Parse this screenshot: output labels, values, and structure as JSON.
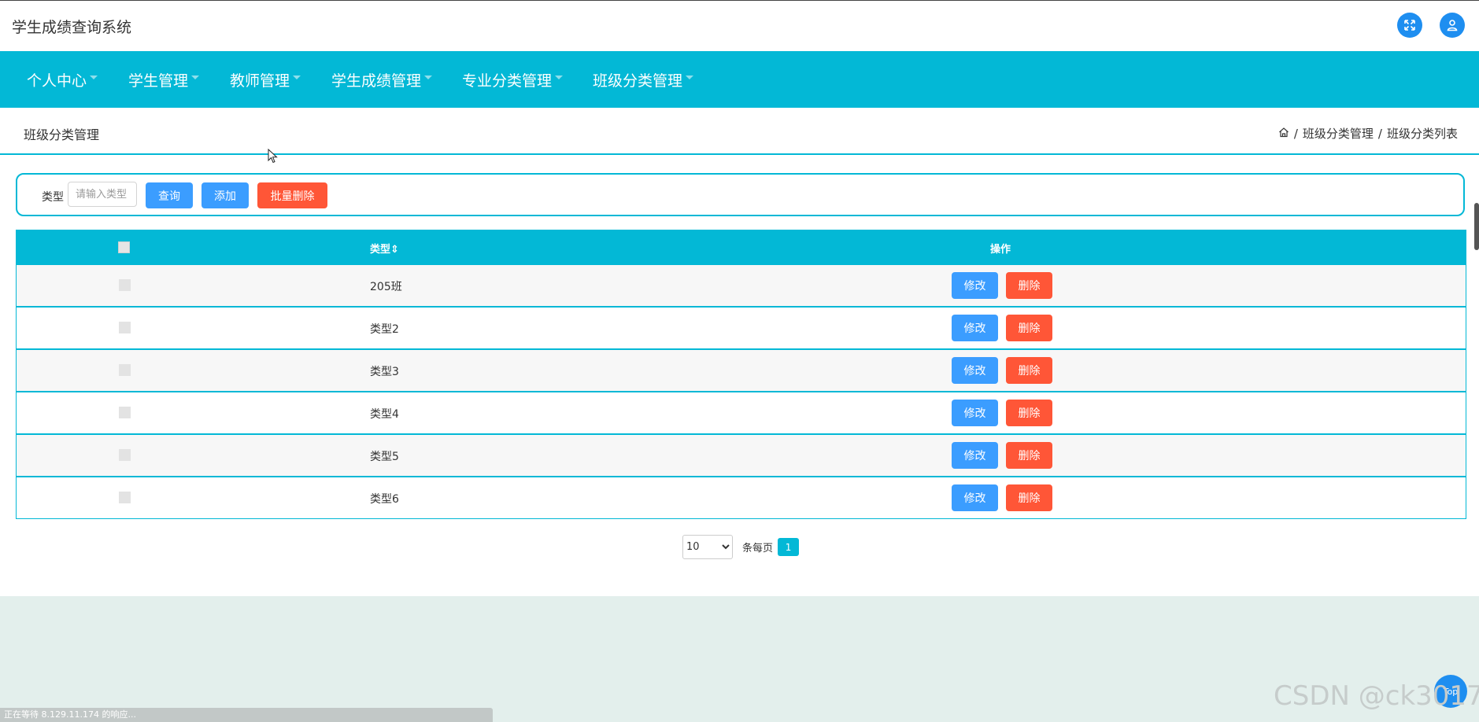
{
  "header": {
    "app_title": "学生成绩查询系统",
    "fullscreen_icon": "fullscreen-icon",
    "user_icon": "user-icon"
  },
  "nav": {
    "items": [
      {
        "label": "个人中心"
      },
      {
        "label": "学生管理"
      },
      {
        "label": "教师管理"
      },
      {
        "label": "学生成绩管理"
      },
      {
        "label": "专业分类管理"
      },
      {
        "label": "班级分类管理"
      }
    ]
  },
  "page": {
    "title": "班级分类管理",
    "breadcrumb": {
      "home_icon": "home-icon",
      "separator": "/",
      "crumb1": "班级分类管理",
      "crumb2": "班级分类列表"
    }
  },
  "search": {
    "label": "类型",
    "placeholder": "请输入类型",
    "query_label": "查询",
    "add_label": "添加",
    "batch_delete_label": "批量删除"
  },
  "table": {
    "columns": [
      "",
      "类型⇕",
      "操作"
    ],
    "rows": [
      {
        "type": "205班",
        "edit_label": "修改",
        "delete_label": "删除"
      },
      {
        "type": "类型2",
        "edit_label": "修改",
        "delete_label": "删除"
      },
      {
        "type": "类型3",
        "edit_label": "修改",
        "delete_label": "删除"
      },
      {
        "type": "类型4",
        "edit_label": "修改",
        "delete_label": "删除"
      },
      {
        "type": "类型5",
        "edit_label": "修改",
        "delete_label": "删除"
      },
      {
        "type": "类型6",
        "edit_label": "修改",
        "delete_label": "删除"
      }
    ]
  },
  "pagination": {
    "page_size": "10",
    "per_page_label": "条每页",
    "current_page": "1"
  },
  "status_bar": {
    "text": "正在等待 8.129.11.174 的响应..."
  },
  "watermark": "CSDN @ck3017",
  "back_to_top_label": "Top",
  "colors": {
    "accent": "#03b8d6",
    "primary_button": "#3b9dff",
    "danger_button": "#ff5637",
    "icon_blue": "#1e8ef0"
  }
}
